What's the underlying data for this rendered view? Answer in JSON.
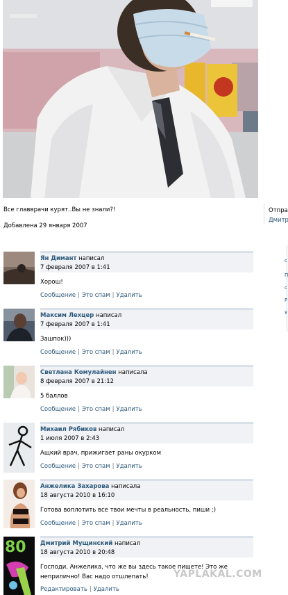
{
  "photo": {
    "alt": "photo-doctor-mask-cigarette"
  },
  "caption": "Все главврачи курят..Вы не знали?!",
  "added": "Добавлена 29 января 2007",
  "side": {
    "send_label": "Отпра",
    "author_label": "Дмитр"
  },
  "right_letters": [
    "",
    "с",
    "П",
    "с",
    "Р",
    "У"
  ],
  "comments": [
    {
      "author": "Ян Димант",
      "verb": "написал",
      "date": "7 февраля 2007 в 1:41",
      "text": "Хорош!",
      "actions": [
        "Сообщение",
        "Это спам",
        "Удалить"
      ]
    },
    {
      "author": "Максим Лехцер",
      "verb": "написал",
      "date": "7 февраля 2007 в 1:41",
      "text": "Зашпок)))",
      "actions": [
        "Сообщение",
        "Это спам",
        "Удалить"
      ]
    },
    {
      "author": "Светлана Комулайнен",
      "verb": "написала",
      "date": "8 февраля 2007 в 21:12",
      "text": "5 баллов",
      "actions": [
        "Сообщение",
        "Это спам",
        "Удалить"
      ]
    },
    {
      "author": "Михаил Рябиков",
      "verb": "написал",
      "date": "1 июля 2007 в 2:43",
      "text": "Ащкий врач, прижигает раны окурком",
      "actions": [
        "Сообщение",
        "Это спам",
        "Удалить"
      ]
    },
    {
      "author": "Анжелика Захарова",
      "verb": "написала",
      "date": "18 августа 2010 в 16:10",
      "text": "Готова воплотить все твои мечты в реальность, пиши ;)",
      "actions": [
        "Сообщение",
        "Это спам",
        "Удалить"
      ]
    },
    {
      "author": "Дмитрий Мущинский",
      "verb": "написал",
      "date": "18 августа 2010 в 20:48",
      "text": "Господи, Анжелика, что же вы здесь такое пишете! Это же неприлично! Вас надо отшлепать!",
      "actions": [
        "Редактировать",
        "Удалить"
      ]
    }
  ],
  "watermark": "YAPLAKAL.COM"
}
